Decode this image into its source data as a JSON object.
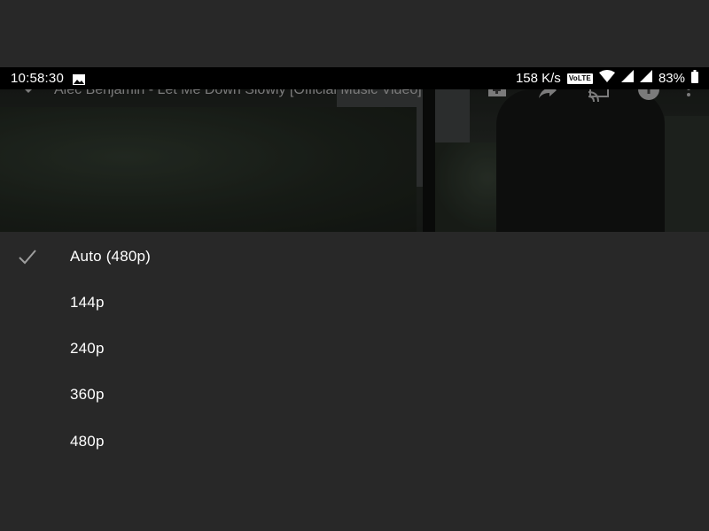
{
  "status_bar": {
    "time": "10:58:30",
    "image_icon": "image-icon",
    "network_speed": "158 K/s",
    "volte_badge": "VoLTE",
    "wifi_icon": "wifi-icon",
    "signal_icons": [
      "signal-icon",
      "signal-icon"
    ],
    "battery_percent": "83%",
    "battery_icon": "battery-icon"
  },
  "video": {
    "title": "Alec Benjamin - Let Me Down Slowly [Official Music Video]",
    "icons": [
      "chevron-down-icon",
      "add-to-playlist-icon",
      "share-icon",
      "cast-icon",
      "info-icon",
      "more-vert-icon"
    ]
  },
  "quality_menu": {
    "selected": "Auto (480p)",
    "items": [
      {
        "label": "Auto (480p)",
        "checked": true
      },
      {
        "label": "144p",
        "checked": false
      },
      {
        "label": "240p",
        "checked": false
      },
      {
        "label": "360p",
        "checked": false
      },
      {
        "label": "480p",
        "checked": false
      }
    ]
  },
  "colors": {
    "background": "#282828",
    "status_bar": "#000000",
    "text": "#ffffff",
    "muted_text": "#7b7b7b",
    "check": "#9e9e9e"
  }
}
